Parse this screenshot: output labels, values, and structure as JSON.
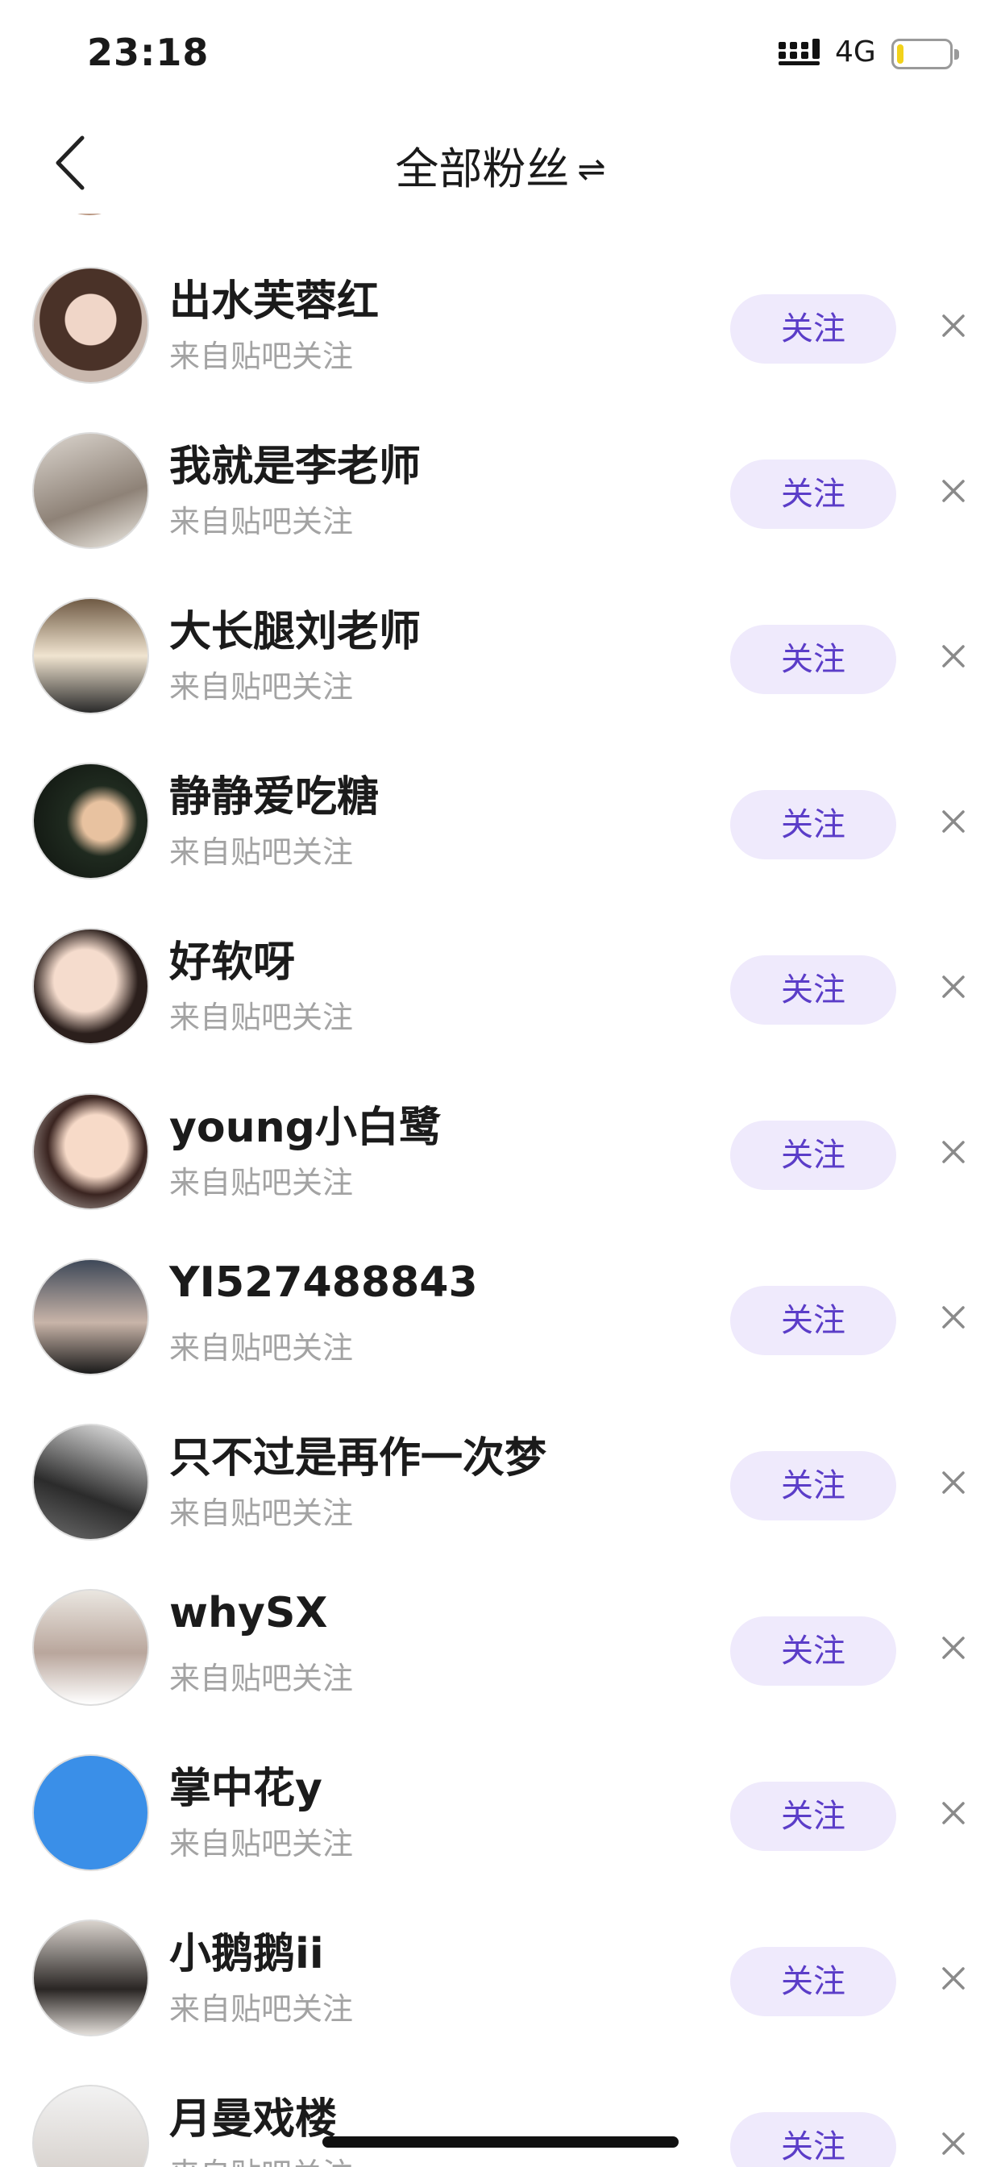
{
  "status_bar": {
    "time": "23:18",
    "network": "4G",
    "battery_level": 0.12,
    "battery_color": "#f2d21a"
  },
  "header": {
    "title": "全部粉丝",
    "swap_icon": "⇌",
    "back_icon": "chevron-left-icon"
  },
  "accent_color": "#5b3dc8",
  "button_bg_color": "#efeafc",
  "fans": [
    {
      "name": "出水芙蓉红",
      "source": "来自贴吧关注",
      "button": "关注"
    },
    {
      "name": "我就是李老师",
      "source": "来自贴吧关注",
      "button": "关注"
    },
    {
      "name": "大长腿刘老师",
      "source": "来自贴吧关注",
      "button": "关注"
    },
    {
      "name": "静静爱吃糖",
      "source": "来自贴吧关注",
      "button": "关注"
    },
    {
      "name": "好软呀",
      "source": "来自贴吧关注",
      "button": "关注"
    },
    {
      "name": "young小白鹭",
      "source": "来自贴吧关注",
      "button": "关注"
    },
    {
      "name": "YI527488843",
      "source": "来自贴吧关注",
      "button": "关注"
    },
    {
      "name": "只不过是再作一次梦",
      "source": "来自贴吧关注",
      "button": "关注"
    },
    {
      "name": "whySX",
      "source": "来自贴吧关注",
      "button": "关注"
    },
    {
      "name": "掌中花y",
      "source": "来自贴吧关注",
      "button": "关注"
    },
    {
      "name": "小鹅鹅ii",
      "source": "来自贴吧关注",
      "button": "关注"
    },
    {
      "name": "月曼戏楼",
      "source": "来自贴吧关注",
      "button": "关注"
    }
  ]
}
